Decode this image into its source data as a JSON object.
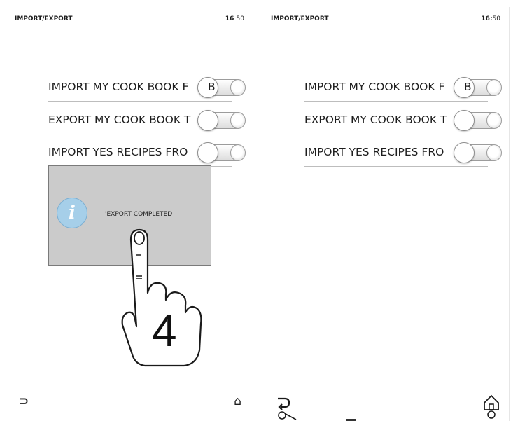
{
  "left_screen": {
    "header": {
      "title": "IMPORT/EXPORT",
      "clock_hours": "16",
      "clock_minutes": "50"
    },
    "rows": [
      {
        "label": "IMPORT MY COOK BOOK F",
        "overflow": "B"
      },
      {
        "label": "EXPORT MY COOK BOOK T",
        "overflow": ""
      },
      {
        "label": "IMPORT YES RECIPES FRO",
        "overflow": ""
      }
    ],
    "dialog": {
      "icon": "info-icon",
      "message": "'EXPORT COMPLETED"
    },
    "step_number": "4"
  },
  "right_screen": {
    "header": {
      "title": "IMPORT/EXPORT",
      "clock_hours": "16:",
      "clock_minutes": "50"
    },
    "rows": [
      {
        "label": "IMPORT MY COOK BOOK F",
        "overflow": "B"
      },
      {
        "label": "EXPORT MY COOK BOOK T",
        "overflow": ""
      },
      {
        "label": "IMPORT YES RECIPES FRO",
        "overflow": ""
      }
    ]
  },
  "icons": {
    "back": "back-arrow-icon",
    "home": "home-icon",
    "hand": "pointing-hand-icon"
  },
  "colors": {
    "dialog_bg": "#cbcbcb",
    "info_icon": "#a6cfe9",
    "divider": "#bdbdbd"
  }
}
